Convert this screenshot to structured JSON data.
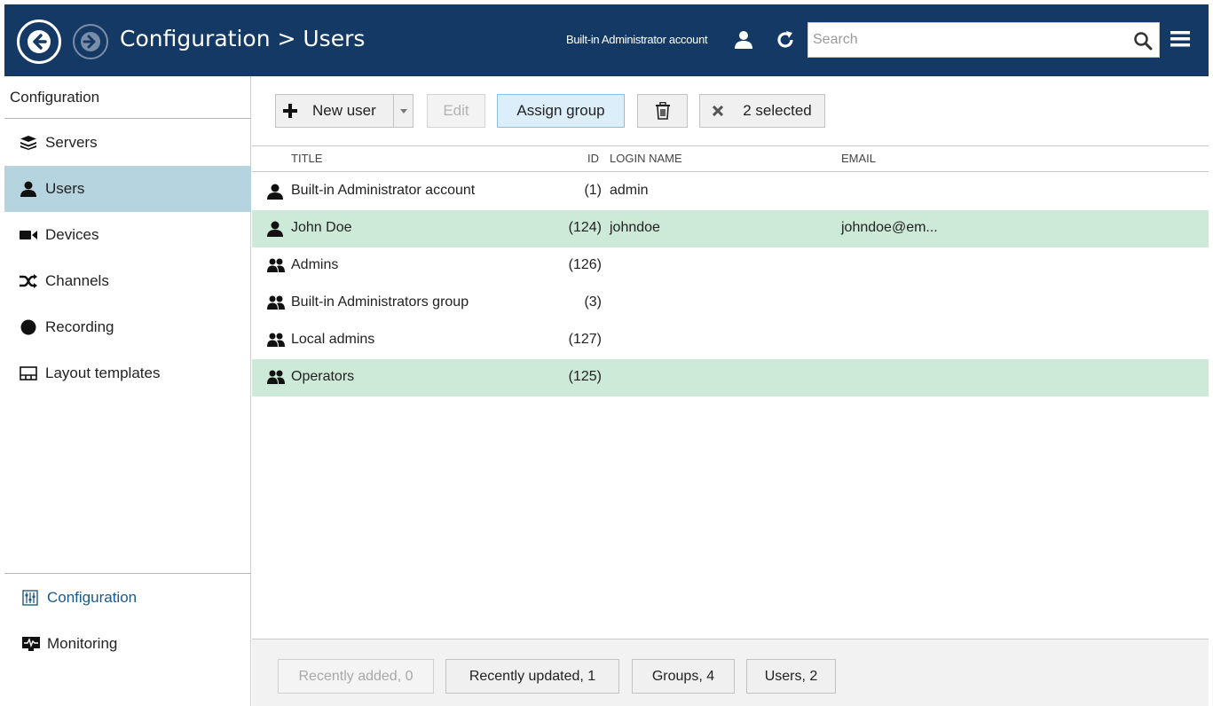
{
  "header": {
    "title": "Configuration > Users",
    "account_label": "Built-in Administrator account",
    "search_placeholder": "Search",
    "search_value": "",
    "background_color": "#143964"
  },
  "sidebar": {
    "heading": "Configuration",
    "items": [
      {
        "label": "Servers",
        "icon": "servers-icon",
        "active": false
      },
      {
        "label": "Users",
        "icon": "user-icon",
        "active": true
      },
      {
        "label": "Devices",
        "icon": "camera-icon",
        "active": false
      },
      {
        "label": "Channels",
        "icon": "shuffle-icon",
        "active": false
      },
      {
        "label": "Recording",
        "icon": "record-icon",
        "active": false
      },
      {
        "label": "Layout templates",
        "icon": "layout-icon",
        "active": false
      }
    ],
    "bottom": [
      {
        "label": "Configuration",
        "icon": "configuration-icon",
        "active": true,
        "color": "#1a5a8a"
      },
      {
        "label": "Monitoring",
        "icon": "monitoring-icon",
        "active": false
      }
    ],
    "active_color": "#b5d4df"
  },
  "toolbar": {
    "new_user_label": "New user",
    "edit_label": "Edit",
    "assign_group_label": "Assign group",
    "selected_label": "2 selected"
  },
  "table": {
    "columns": [
      "TITLE",
      "ID",
      "LOGIN NAME",
      "EMAIL"
    ],
    "rows": [
      {
        "title": "Built-in Administrator account",
        "id": "(1)",
        "login": "admin",
        "email": "",
        "type": "user",
        "selected": false
      },
      {
        "title": "John Doe",
        "id": "(124)",
        "login": "johndoe",
        "email": "johndoe@em...",
        "type": "user",
        "selected": true
      },
      {
        "title": "Admins",
        "id": "(126)",
        "login": "",
        "email": "",
        "type": "group",
        "selected": false
      },
      {
        "title": "Built-in Administrators group",
        "id": "(3)",
        "login": "",
        "email": "",
        "type": "group",
        "selected": false
      },
      {
        "title": "Local admins",
        "id": "(127)",
        "login": "",
        "email": "",
        "type": "group",
        "selected": false
      },
      {
        "title": "Operators",
        "id": "(125)",
        "login": "",
        "email": "",
        "type": "group",
        "selected": true
      }
    ],
    "selected_color": "#cde9d7"
  },
  "footer": {
    "filters": [
      {
        "label": "Recently added, 0",
        "disabled": true
      },
      {
        "label": "Recently updated, 1",
        "disabled": false
      },
      {
        "label": "Groups, 4",
        "disabled": false
      },
      {
        "label": "Users, 2",
        "disabled": false
      }
    ]
  }
}
